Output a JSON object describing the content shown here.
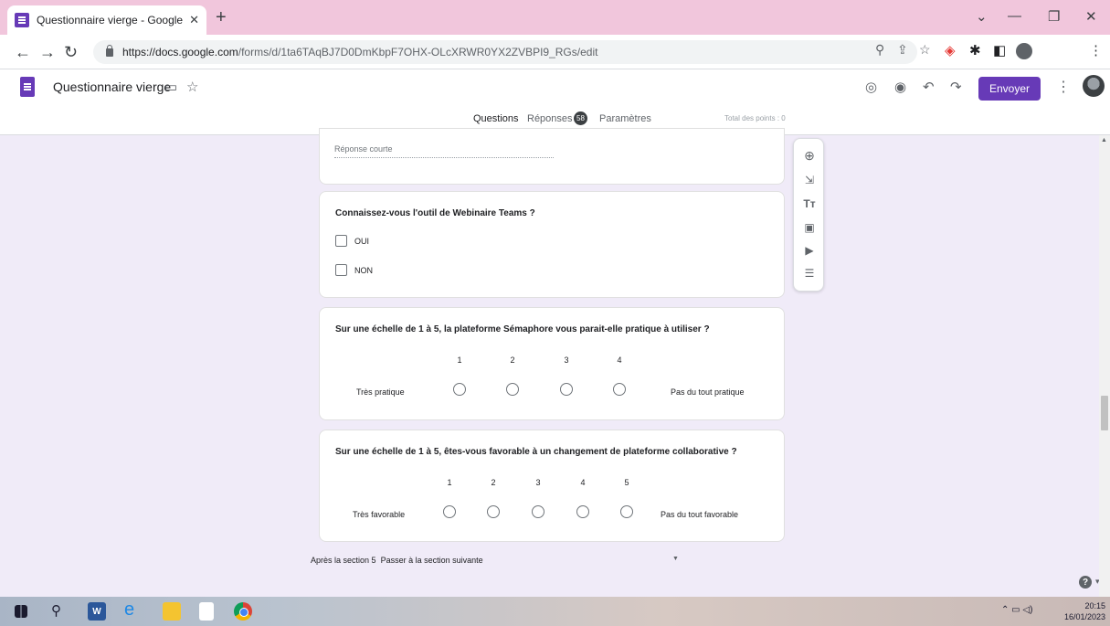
{
  "browser": {
    "tab_title": "Questionnaire vierge - Google Fo",
    "tab_close": "✕",
    "new_tab": "+",
    "url_domain": "https://docs.google.com",
    "url_path": "/forms/d/1ta6TAqBJ7D0DmKbpF7OHX-OLcXRWR0YX2ZVBPI9_RGs/edit"
  },
  "form_header": {
    "title": "Questionnaire vierge",
    "send_label": "Envoyer",
    "tabs": {
      "questions": "Questions",
      "responses": "Réponses",
      "responses_count": "58",
      "settings": "Paramètres"
    },
    "total_points": "Total des points : 0"
  },
  "cards": {
    "short_answer_placeholder": "Réponse courte",
    "q_teams": {
      "title": "Connaissez-vous l'outil de Webinaire Teams ?",
      "options": [
        "OUI",
        "NON"
      ]
    },
    "q_semaphore": {
      "title": "Sur une échelle de 1 à 5, la plateforme Sémaphore vous parait-elle pratique à utiliser ?",
      "scale": [
        "1",
        "2",
        "3",
        "4"
      ],
      "min_label": "Très pratique",
      "max_label": "Pas du tout pratique"
    },
    "q_collab": {
      "title": "Sur une échelle de 1 à 5, êtes-vous favorable à un changement de plateforme collaborative ?",
      "scale": [
        "1",
        "2",
        "3",
        "4",
        "5"
      ],
      "min_label": "Très favorable",
      "max_label": "Pas du tout favorable"
    }
  },
  "footer": {
    "after_section": "Après la section 5",
    "next_action": "Passer à la section suivante"
  },
  "taskbar": {
    "time": "20:15",
    "date": "16/01/2023"
  },
  "colors": {
    "accent": "#673ab7",
    "background": "#f0ebf8",
    "tabstrip": "#f1c6dc"
  }
}
